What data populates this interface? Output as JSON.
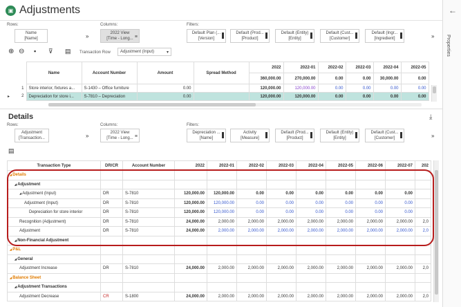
{
  "app": {
    "title": "Adjustments",
    "properties_label": "Properties"
  },
  "top": {
    "rows_label": "Rows:",
    "rows_pill": [
      "Name",
      "[Name]"
    ],
    "columns_label": "Columns:",
    "columns_pill": [
      "2022 View",
      "[Time - Long..."
    ],
    "filters_label": "Filters:",
    "filters": [
      [
        "Default Plan (...",
        "[Version]"
      ],
      [
        "Default (Prod...",
        "[Product]"
      ],
      [
        "Default (Entity)",
        "[Entity]"
      ],
      [
        "Default (Cust...",
        "[Customer]"
      ],
      [
        "Default (Ingr...",
        "[Ingredient]"
      ]
    ],
    "transaction_row_label": "Transaction Row",
    "transaction_row_value": "Adjustment (Input)"
  },
  "top_grid": {
    "headers": [
      "Name",
      "Account Number",
      "Amount",
      "Spread Method",
      "2022",
      "2022-01",
      "2022-02",
      "2022-03",
      "2022-04",
      "2022-05"
    ],
    "totals": [
      "360,000.00",
      "270,000.00",
      "0.00",
      "0.00",
      "30,000.00",
      "0.00"
    ],
    "rows": [
      {
        "n": "1",
        "name": "Store interior, fixtures a...",
        "acct": "S-1430 – Office furniture",
        "amount": "0.00",
        "spread": "",
        "vals": [
          "120,000.00",
          "120,000.00",
          "0.00",
          "0.00",
          "0.00",
          "0.00"
        ]
      },
      {
        "n": "2",
        "name": "Depreciation for store i...",
        "acct": "S-7810 – Depreciation",
        "amount": "0.00",
        "spread": "",
        "vals": [
          "120,000.00",
          "120,000.00",
          "0.00",
          "0.00",
          "0.00",
          "0.00"
        ]
      }
    ]
  },
  "details": {
    "title": "Details",
    "rows_label": "Rows:",
    "rows_pill": [
      "Adjustment",
      "[Transaction..."
    ],
    "columns_label": "Columns:",
    "columns_pill": [
      "2022 View",
      "[Time - Long..."
    ],
    "filters_label": "Filters:",
    "filters": [
      [
        "Depreciation ...",
        "[Name]"
      ],
      [
        "Activity",
        "[Measure]"
      ],
      [
        "Default (Prod...",
        "[Product]"
      ],
      [
        "Default (Entity)",
        "[Entity]"
      ],
      [
        "Default (Cust...",
        "[Customer]"
      ]
    ],
    "headers": [
      "Transaction Type",
      "DR/CR",
      "Account Number",
      "2022",
      "2022-01",
      "2022-02",
      "2022-03",
      "2022-04",
      "2022-05",
      "2022-06",
      "2022-07",
      "202"
    ],
    "rows": [
      {
        "label": "Details",
        "lvl": 0,
        "style": "orange",
        "drcr": "",
        "acct": "",
        "vals": []
      },
      {
        "label": "Adjustment",
        "lvl": 1,
        "style": "bold",
        "drcr": "",
        "acct": "",
        "vals": []
      },
      {
        "label": "Adjustment (Input)",
        "lvl": 2,
        "style": "",
        "drcr": "DR",
        "acct": "S-7810",
        "vals": [
          "120,000.00",
          "120,000.00",
          "0.00",
          "0.00",
          "0.00",
          "0.00",
          "0.00",
          "0.00",
          ""
        ]
      },
      {
        "label": "Adjustment (Input)",
        "lvl": 3,
        "style": "",
        "drcr": "DR",
        "acct": "S-7810",
        "vals": [
          "120,000.00",
          "120,000.00",
          "0.00",
          "0.00",
          "0.00",
          "0.00",
          "0.00",
          "0.00",
          ""
        ]
      },
      {
        "label": "Depreciation for store interior",
        "lvl": 4,
        "style": "",
        "drcr": "DR",
        "acct": "S-7810",
        "vals": [
          "120,000.00",
          "120,000.00",
          "0.00",
          "0.00",
          "0.00",
          "0.00",
          "0.00",
          "0.00",
          ""
        ]
      },
      {
        "label": "Recognition (Adjustment)",
        "lvl": 2,
        "style": "",
        "drcr": "DR",
        "acct": "S-7810",
        "vals": [
          "24,000.00",
          "2,000.00",
          "2,000.00",
          "2,000.00",
          "2,000.00",
          "2,000.00",
          "2,000.00",
          "2,000.00",
          "2,0"
        ]
      },
      {
        "label": "Adjustment",
        "lvl": 2,
        "style": "",
        "drcr": "DR",
        "acct": "S-7810",
        "vals": [
          "24,000.00",
          "2,000.00",
          "2,000.00",
          "2,000.00",
          "2,000.00",
          "2,000.00",
          "2,000.00",
          "2,000.00",
          "2,0"
        ]
      },
      {
        "label": "Non-Financial Adjustment",
        "lvl": 1,
        "style": "bold",
        "drcr": "",
        "acct": "",
        "vals": []
      },
      {
        "label": "P&L",
        "lvl": 0,
        "style": "orange",
        "drcr": "",
        "acct": "",
        "vals": []
      },
      {
        "label": "General",
        "lvl": 1,
        "style": "bold",
        "drcr": "",
        "acct": "",
        "vals": []
      },
      {
        "label": "Adjustment Increase",
        "lvl": 2,
        "style": "",
        "drcr": "DR",
        "acct": "S-7810",
        "vals": [
          "24,000.00",
          "2,000.00",
          "2,000.00",
          "2,000.00",
          "2,000.00",
          "2,000.00",
          "2,000.00",
          "2,000.00",
          "2,0"
        ]
      },
      {
        "label": "Balance Sheet",
        "lvl": 0,
        "style": "orange",
        "drcr": "",
        "acct": "",
        "vals": []
      },
      {
        "label": "Adjustment Transactions",
        "lvl": 1,
        "style": "bold",
        "drcr": "",
        "acct": "",
        "vals": []
      },
      {
        "label": "Adjustment Decrease",
        "lvl": 2,
        "style": "",
        "drcr": "CR",
        "acct": "S-1800",
        "vals": [
          "24,000.00",
          "2,000.00",
          "2,000.00",
          "2,000.00",
          "2,000.00",
          "2,000.00",
          "2,000.00",
          "2,000.00",
          "2,0"
        ]
      }
    ]
  },
  "colors": {
    "accent": "#2e8b57",
    "highlight": "#bfe3de",
    "oval": "#b71c1c",
    "section": "#e07b00",
    "link": "#3355cc"
  },
  "icons": [
    "adjustments-app-icon",
    "back-arrow-icon",
    "add-icon",
    "remove-icon",
    "save-icon",
    "filter-icon",
    "export-icon",
    "download-icon",
    "chevron-double-down-icon"
  ]
}
